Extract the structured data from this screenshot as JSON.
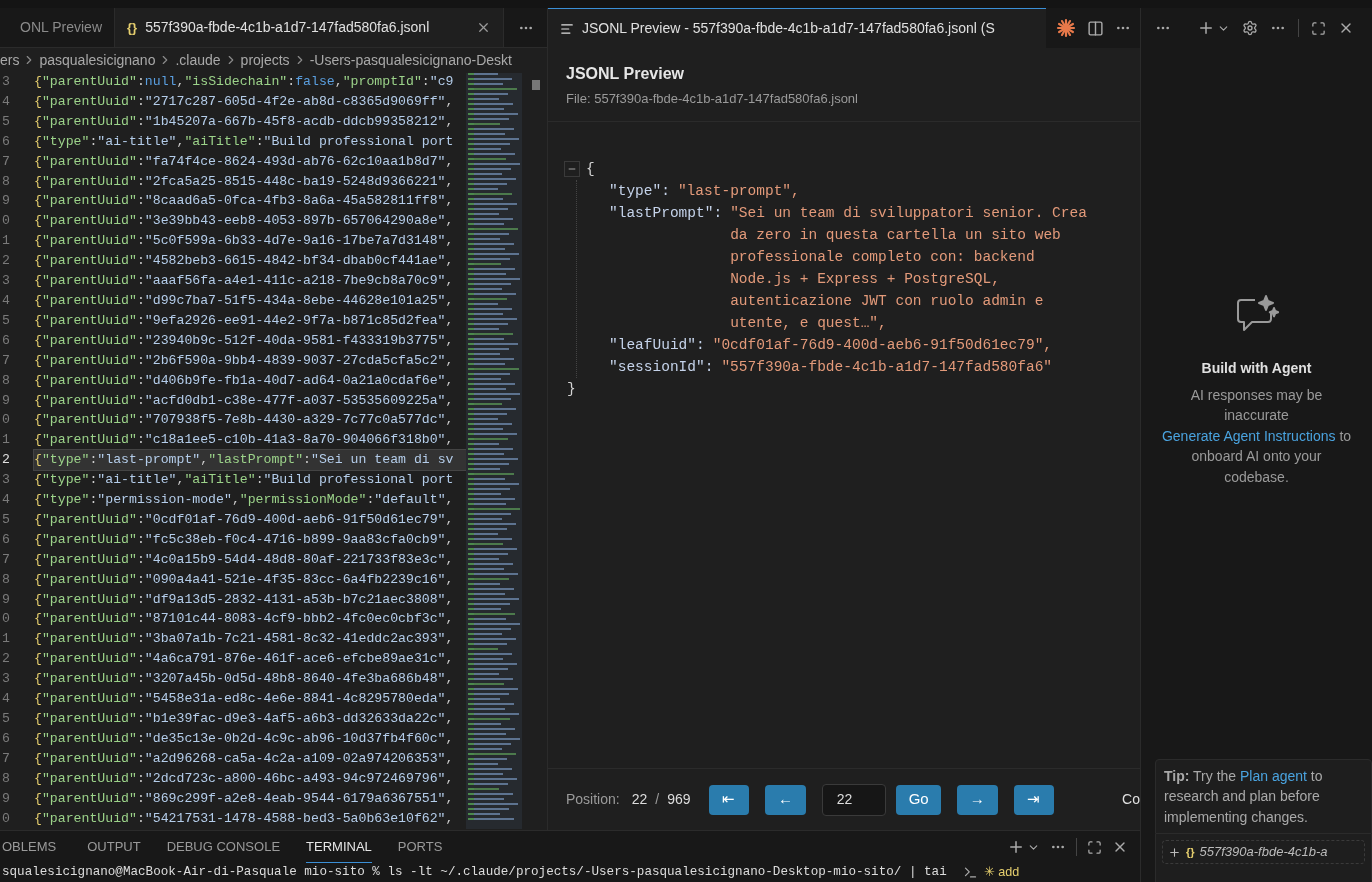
{
  "editor_tabs": [
    {
      "label": "ONL Preview",
      "selected": false,
      "kind": "preview"
    },
    {
      "label": "557f390a-fbde-4c1b-a1d7-147fad580fa6.jsonl",
      "selected": true,
      "kind": "json",
      "icon_text": "{}"
    }
  ],
  "breadcrumb": [
    "ers",
    "pasqualesicignano",
    ".claude",
    "projects",
    "-Users-pasqualesicignano-Deskt"
  ],
  "editor": {
    "lines": [
      {
        "number": "3",
        "text": "{\"parentUuid\":null,\"isSidechain\":false,\"promptId\":\"c9",
        "current": false
      },
      {
        "number": "4",
        "text": "{\"parentUuid\":\"2717c287-605d-4f2e-ab8d-c8365d9069ff\",",
        "current": false
      },
      {
        "number": "5",
        "text": "{\"parentUuid\":\"1b45207a-667b-45f8-acdb-ddcb99358212\",",
        "current": false
      },
      {
        "number": "6",
        "text": "{\"type\":\"ai-title\",\"aiTitle\":\"Build professional port",
        "current": false
      },
      {
        "number": "7",
        "text": "{\"parentUuid\":\"fa74f4ce-8624-493d-ab76-62c10aa1b8d7\",",
        "current": false
      },
      {
        "number": "8",
        "text": "{\"parentUuid\":\"2fca5a25-8515-448c-ba19-5248d9366221\",",
        "current": false
      },
      {
        "number": "9",
        "text": "{\"parentUuid\":\"8caad6a5-0fca-4fb3-8a6a-45a582811ff8\",",
        "current": false
      },
      {
        "number": "0",
        "text": "{\"parentUuid\":\"3e39bb43-eeb8-4053-897b-657064290a8e\",",
        "current": false
      },
      {
        "number": "1",
        "text": "{\"parentUuid\":\"5c0f599a-6b33-4d7e-9a16-17be7a7d3148\",",
        "current": false
      },
      {
        "number": "2",
        "text": "{\"parentUuid\":\"4582beb3-6615-4842-bf34-dbab0cf441ae\",",
        "current": false
      },
      {
        "number": "3",
        "text": "{\"parentUuid\":\"aaaf56fa-a4e1-411c-a218-7be9cb8a70c9\",",
        "current": false
      },
      {
        "number": "4",
        "text": "{\"parentUuid\":\"d99c7ba7-51f5-434a-8ebe-44628e101a25\",",
        "current": false
      },
      {
        "number": "5",
        "text": "{\"parentUuid\":\"9efa2926-ee91-44e2-9f7a-b871c85d2fea\",",
        "current": false
      },
      {
        "number": "6",
        "text": "{\"parentUuid\":\"23940b9c-512f-40da-9581-f433319b3775\",",
        "current": false
      },
      {
        "number": "7",
        "text": "{\"parentUuid\":\"2b6f590a-9bb4-4839-9037-27cda5cfa5c2\",",
        "current": false
      },
      {
        "number": "8",
        "text": "{\"parentUuid\":\"d406b9fe-fb1a-40d7-ad64-0a21a0cdaf6e\",",
        "current": false
      },
      {
        "number": "9",
        "text": "{\"parentUuid\":\"acfd0db1-c38e-477f-a037-53535609225a\",",
        "current": false
      },
      {
        "number": "0",
        "text": "{\"parentUuid\":\"707938f5-7e8b-4430-a329-7c77c0a577dc\",",
        "current": false
      },
      {
        "number": "1",
        "text": "{\"parentUuid\":\"c18a1ee5-c10b-41a3-8a70-904066f318b0\",",
        "current": false
      },
      {
        "number": "2",
        "text": "{\"type\":\"last-prompt\",\"lastPrompt\":\"Sei un team di sv",
        "current": true
      },
      {
        "number": "3",
        "text": "{\"type\":\"ai-title\",\"aiTitle\":\"Build professional port",
        "current": false
      },
      {
        "number": "4",
        "text": "{\"type\":\"permission-mode\",\"permissionMode\":\"default\",",
        "current": false
      },
      {
        "number": "5",
        "text": "{\"parentUuid\":\"0cdf01af-76d9-400d-aeb6-91f50d61ec79\",",
        "current": false
      },
      {
        "number": "6",
        "text": "{\"parentUuid\":\"fc5c38eb-f0c4-4716-b899-9aa83cfa0cb9\",",
        "current": false
      },
      {
        "number": "7",
        "text": "{\"parentUuid\":\"4c0a15b9-54d4-48d8-80af-221733f83e3c\",",
        "current": false
      },
      {
        "number": "8",
        "text": "{\"parentUuid\":\"090a4a41-521e-4f35-83cc-6a4fb2239c16\",",
        "current": false
      },
      {
        "number": "9",
        "text": "{\"parentUuid\":\"df9a13d5-2832-4131-a53b-b7c21aec3808\",",
        "current": false
      },
      {
        "number": "0",
        "text": "{\"parentUuid\":\"87101c44-8083-4cf9-bbb2-4fc0ec0cbf3c\",",
        "current": false
      },
      {
        "number": "1",
        "text": "{\"parentUuid\":\"3ba07a1b-7c21-4581-8c32-41eddc2ac393\",",
        "current": false
      },
      {
        "number": "2",
        "text": "{\"parentUuid\":\"4a6ca791-876e-461f-ace6-efcbe89ae31c\",",
        "current": false
      },
      {
        "number": "3",
        "text": "{\"parentUuid\":\"3207a45b-0d5d-48b8-8640-4fe3ba686b48\",",
        "current": false
      },
      {
        "number": "4",
        "text": "{\"parentUuid\":\"5458e31a-ed8c-4e6e-8841-4c8295780eda\",",
        "current": false
      },
      {
        "number": "5",
        "text": "{\"parentUuid\":\"b1e39fac-d9e3-4af5-a6b3-dd32633da22c\",",
        "current": false
      },
      {
        "number": "6",
        "text": "{\"parentUuid\":\"de35c13e-0b2d-4c9c-ab96-10d37fb4f60c\",",
        "current": false
      },
      {
        "number": "7",
        "text": "{\"parentUuid\":\"a2d96268-ca5a-4c2a-a109-02a974206353\",",
        "current": false
      },
      {
        "number": "8",
        "text": "{\"parentUuid\":\"2dcd723c-a800-46bc-a493-94c972469796\",",
        "current": false
      },
      {
        "number": "9",
        "text": "{\"parentUuid\":\"869c299f-a2e8-4eab-9544-6179a6367551\",",
        "current": false
      },
      {
        "number": "0",
        "text": "{\"parentUuid\":\"54217531-1478-4588-bed3-5a0b63e10f62\",",
        "current": false
      }
    ]
  },
  "preview": {
    "tab": {
      "label": "JSONL Preview - 557f390a-fbde-4c1b-a1d7-147fad580fa6.jsonl (S",
      "selected": true
    },
    "title": "JSONL Preview",
    "file": "File: 557f390a-fbde-4c1b-a1d7-147fad580fa6.jsonl",
    "json": {
      "open": "{",
      "close": "}",
      "expanded": true,
      "entries": [
        {
          "key": "\"type\":",
          "value": "\"last-prompt\","
        },
        {
          "key": "\"lastPrompt\":",
          "value": "\"Sei un team di sviluppatori senior. Crea da zero in questa cartella un sito web professionale completo con: backend Node.js + Express + PostgreSQL, autenticazione JWT con ruolo admin e utente, e quest…\","
        },
        {
          "key": "\"leafUuid\":",
          "value": "\"0cdf01af-76d9-400d-aeb6-91f50d61ec79\","
        },
        {
          "key": "\"sessionId\":",
          "value": "\"557f390a-fbde-4c1b-a1d7-147fad580fa6\""
        }
      ]
    },
    "nav": {
      "label": "Position:",
      "current": "22",
      "separator": "/",
      "total": "969",
      "first": "⇤",
      "prev": "←",
      "input": "22",
      "go": "Go",
      "next": "→",
      "last": "⇥",
      "cut_text": "Co"
    }
  },
  "agent": {
    "title": "Build with Agent",
    "note": "AI responses may be inaccurate",
    "link": "Generate Agent Instructions",
    "rest": "to onboard AI onto your codebase.",
    "tip": "**Tip:** Try the",
    "tip_link": "Plan agent",
    "tip_rest": "to research and plan before implementing changes.",
    "attachment": {
      "icon_text": "{}",
      "label": "557f390a-fbde-4c1b-a"
    }
  },
  "panel": {
    "tabs": [
      {
        "label": "OBLEMS",
        "selected": false
      },
      {
        "label": "OUTPUT",
        "selected": false
      },
      {
        "label": "DEBUG CONSOLE",
        "selected": false
      },
      {
        "label": "TERMINAL",
        "selected": true
      },
      {
        "label": "PORTS",
        "selected": false
      }
    ],
    "terminal_line": "squalesicignano@MacBook-Air-di-Pasquale mio-sito % ls -lt ~/.claude/projects/-Users-pasqualesicignano-Desktop-mio-sito/ | tai",
    "terminal_tab": "✳ add"
  }
}
